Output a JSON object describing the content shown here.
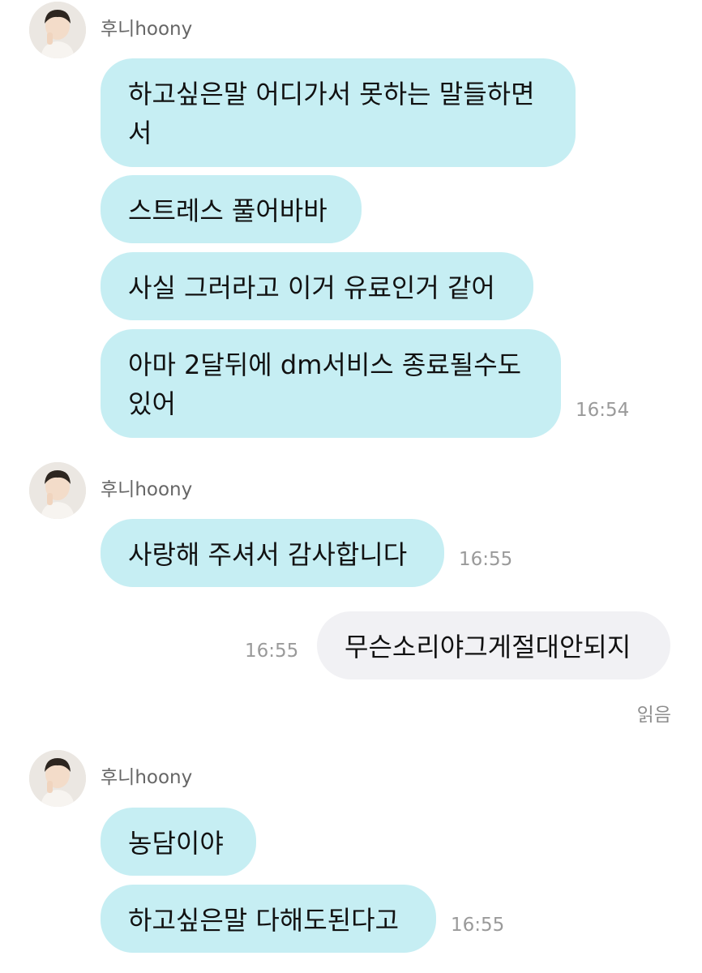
{
  "groups": [
    {
      "sender": "후니hoony",
      "avatar_icon": "user-avatar-photo",
      "messages": [
        {
          "text": "하고싶은말 어디가서 못하는 말들하면\n서"
        },
        {
          "text": "스트레스 풀어바바"
        },
        {
          "text": "사실 그러라고 이거 유료인거 같어"
        },
        {
          "text": "아마 2달뒤에 dm서비스 종료될수도\n있어",
          "time": "16:54"
        }
      ]
    },
    {
      "sender": "후니hoony",
      "avatar_icon": "user-avatar-photo",
      "messages": [
        {
          "text": "사랑해 주셔서 감사합니다",
          "time": "16:55"
        }
      ]
    },
    {
      "outgoing": [
        {
          "text": "무슨소리야그게절대안되지",
          "time": "16:55",
          "status": "읽음"
        }
      ]
    },
    {
      "sender": "후니hoony",
      "avatar_icon": "user-avatar-photo",
      "messages": [
        {
          "text": "농담이야"
        },
        {
          "text": "하고싶은말 다해도된다고",
          "time": "16:55"
        }
      ]
    }
  ],
  "colors": {
    "incoming_bubble": "#c6eef3",
    "outgoing_bubble": "#f1f1f4",
    "timestamp": "#9a9a9a"
  }
}
